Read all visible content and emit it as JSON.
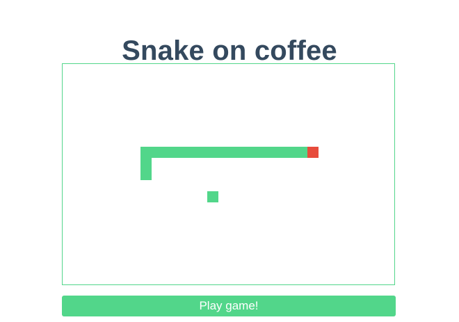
{
  "title": "Snake on coffee",
  "play_button_label": "Play game!",
  "colors": {
    "title": "#34495e",
    "snake": "#52d68a",
    "snake_head": "#e74c3c",
    "food": "#52d68a",
    "board_border": "#52d68a",
    "button": "#52d68a"
  },
  "game": {
    "grid_columns": 30,
    "grid_rows": 20,
    "snake_head": [
      21,
      7
    ],
    "snake_body": [
      [
        20,
        7
      ],
      [
        19,
        7
      ],
      [
        18,
        7
      ],
      [
        17,
        7
      ],
      [
        16,
        7
      ],
      [
        15,
        7
      ],
      [
        14,
        7
      ],
      [
        13,
        7
      ],
      [
        12,
        7
      ],
      [
        11,
        7
      ],
      [
        10,
        7
      ],
      [
        9,
        7
      ],
      [
        8,
        7
      ],
      [
        7,
        7
      ],
      [
        6,
        7
      ],
      [
        6,
        8
      ],
      [
        6,
        9
      ]
    ],
    "food": [
      12,
      11
    ]
  }
}
